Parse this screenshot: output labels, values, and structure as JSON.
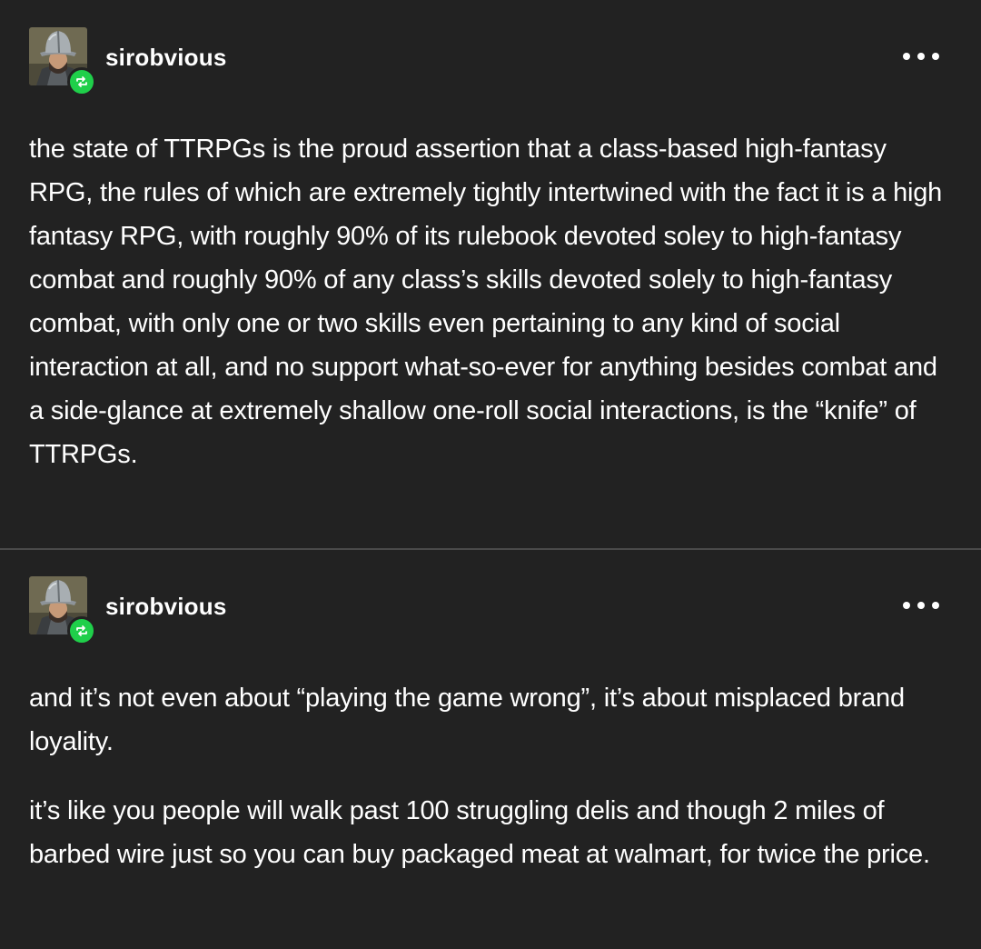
{
  "posts": [
    {
      "username": "sirobvious",
      "avatar_icon": "helmeted-knight-avatar",
      "badge_icon": "reblog-icon",
      "menu_icon": "more-options-icon",
      "paragraphs": [
        "the state of TTRPGs is the proud assertion that a class-based high-fantasy RPG, the rules of which are extremely tightly intertwined with the fact it is a high fantasy RPG, with roughly 90% of its rulebook devoted soley to high-fantasy combat and roughly 90% of any class’s skills devoted solely to high-fantasy combat, with only one or two skills even pertaining to any kind of social interaction at all, and no support what-so-ever for anything besides combat and a side-glance at extremely shallow one-roll social interactions, is the “knife” of TTRPGs."
      ]
    },
    {
      "username": "sirobvious",
      "avatar_icon": "helmeted-knight-avatar",
      "badge_icon": "reblog-icon",
      "menu_icon": "more-options-icon",
      "paragraphs": [
        "and it’s not even about “playing the game wrong”, it’s about misplaced brand loyality.",
        "it’s like you people will walk past 100 struggling delis and though 2 miles of barbed wire just so you can buy packaged meat at walmart, for twice the price."
      ]
    }
  ],
  "colors": {
    "background": "#222222",
    "text": "#ffffff",
    "reblog_badge": "#1fcf4a",
    "divider": "#4a4a4a"
  }
}
